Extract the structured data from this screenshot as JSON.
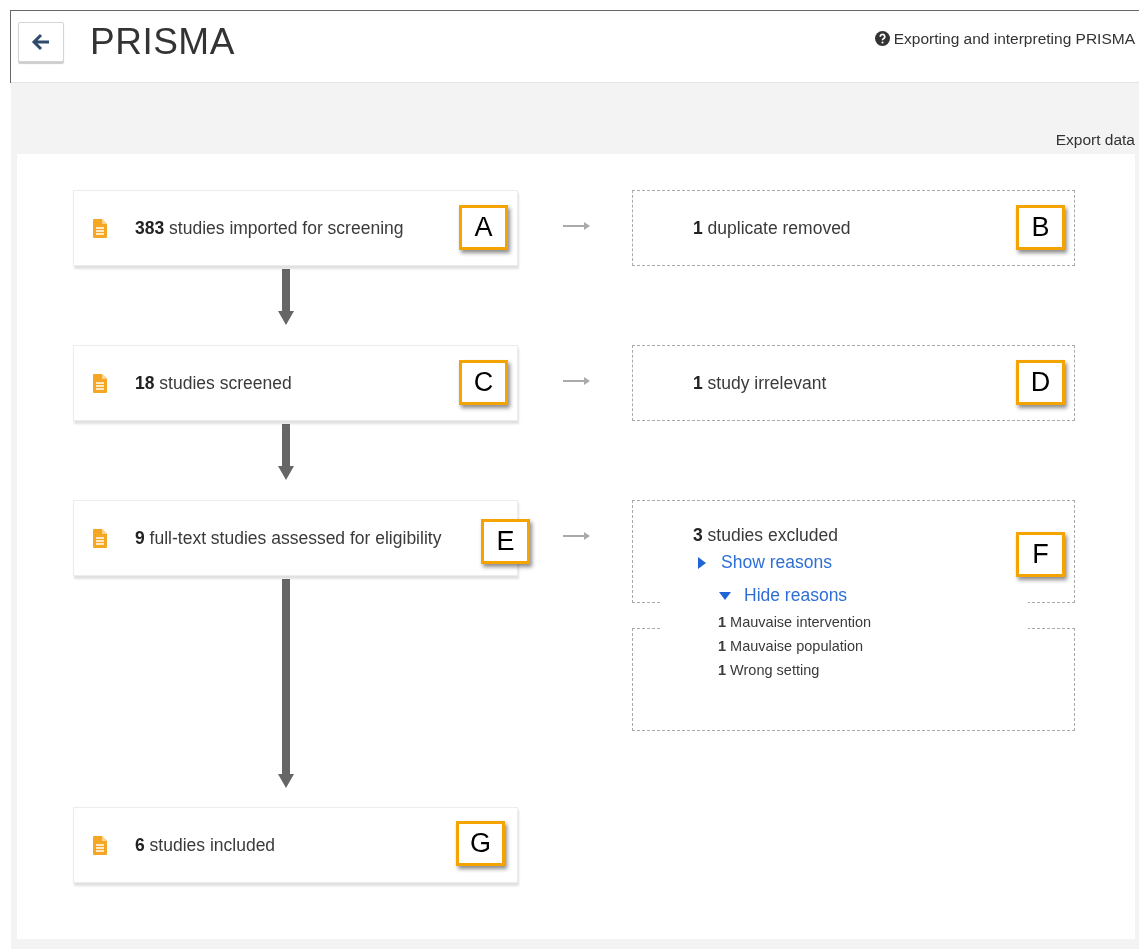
{
  "header": {
    "title": "PRISMA",
    "help_link": "Exporting and interpreting PRISMA"
  },
  "export_link": "Export data",
  "stages": [
    {
      "text": "**383** studies imported for screening",
      "callout": "A",
      "side": {
        "text": "**1** duplicate removed",
        "callout": "B"
      }
    },
    {
      "text": "**18** studies screened",
      "callout": "C",
      "side": {
        "text": "**1** study irrelevant",
        "callout": "D"
      }
    },
    {
      "text": "**9** full-text studies assessed for eligibility",
      "callout": "E",
      "side": {
        "text": "**3** studies excluded",
        "callout": "F",
        "toggle": {
          "label": "Show reasons",
          "expanded": false
        },
        "popup": {
          "toggle": {
            "label": "Hide reasons",
            "expanded": true
          },
          "reasons": [
            {
              "text": "**1** Mauvaise intervention"
            },
            {
              "text": "**1** Mauvaise population"
            },
            {
              "text": "**1** Wrong setting"
            }
          ]
        }
      },
      "extra_box": true
    },
    {
      "text": "**6** studies included",
      "callout": "G"
    }
  ]
}
